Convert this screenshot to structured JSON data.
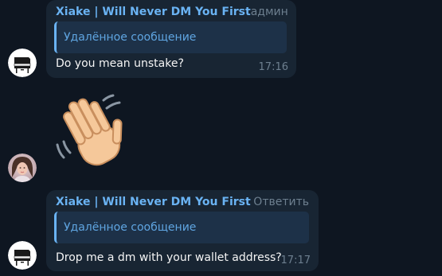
{
  "messages": [
    {
      "sender": "Xiake | Will Never DM You First",
      "role": "админ",
      "reply_preview": "Удалённое сообщение",
      "text": "Do you mean unstake?",
      "time": "17:16",
      "avatar_icon": "piano-icon"
    },
    {
      "sticker": "waving-hand-icon",
      "avatar_icon": "user-photo"
    },
    {
      "sender": "Xiake | Will Never DM You First",
      "action": "Ответить",
      "reply_preview": "Удалённое сообщение",
      "text": "Drop me a dm with your wallet address?",
      "time": "17:17",
      "avatar_icon": "piano-icon"
    }
  ],
  "colors": {
    "background": "#0e1621",
    "bubble": "#182533",
    "sender": "#6ab3f3",
    "reply_bg": "#1d3148",
    "muted": "#6d7f8f",
    "text": "#f5f5f5"
  }
}
